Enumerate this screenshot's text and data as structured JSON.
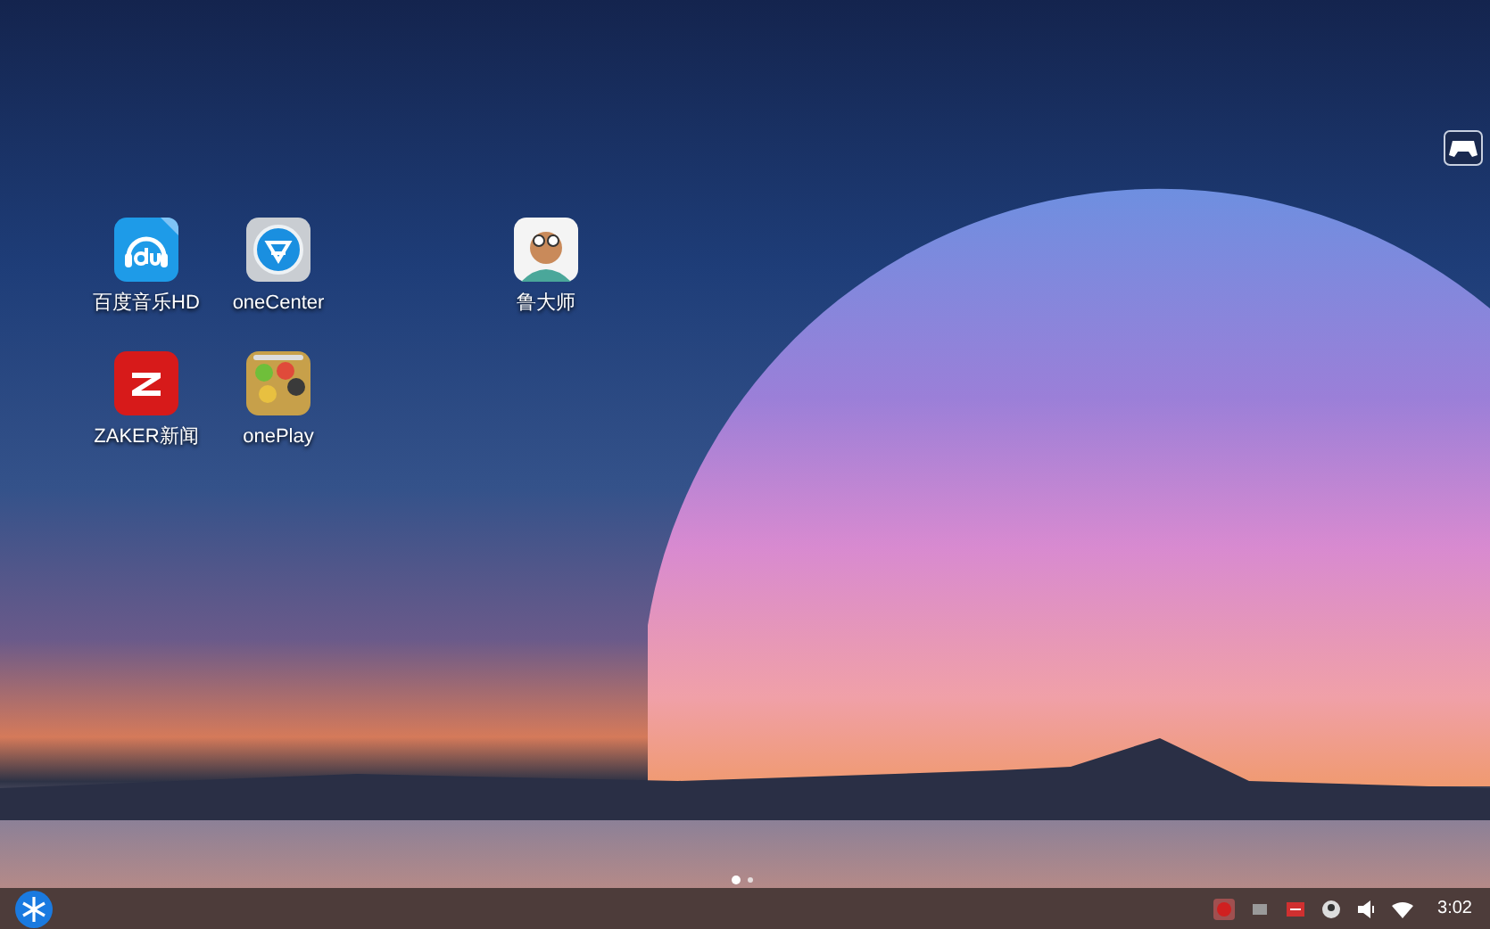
{
  "desktop_apps": [
    {
      "label": "百度音乐HD",
      "kind": "music"
    },
    {
      "label": "oneCenter",
      "kind": "center"
    },
    {
      "label": "鲁大师",
      "kind": "avatar"
    },
    {
      "label": "ZAKER新闻",
      "kind": "news"
    },
    {
      "label": "onePlay",
      "kind": "games"
    }
  ],
  "page_dots": [
    {
      "selected": true
    },
    {
      "selected": false
    }
  ],
  "taskbar": {
    "clock": "3:02"
  }
}
